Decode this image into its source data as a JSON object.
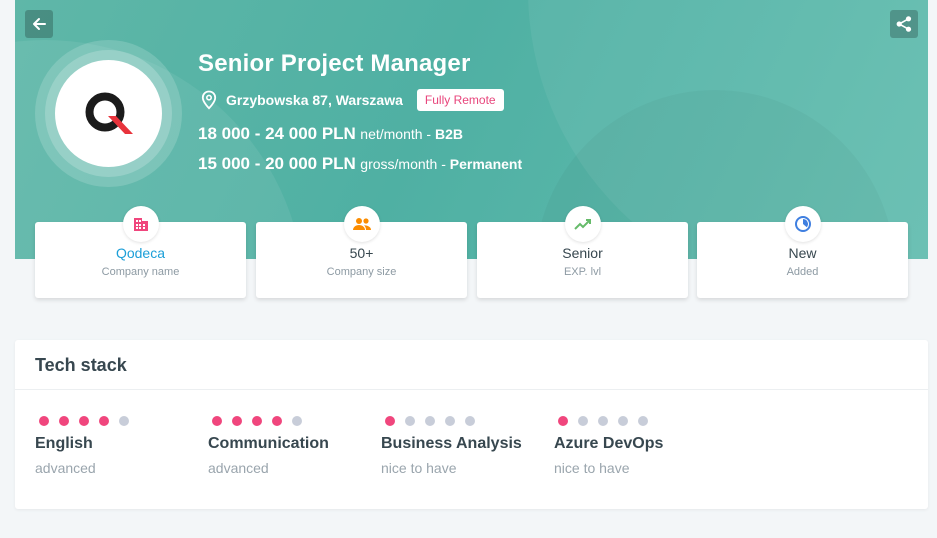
{
  "header": {
    "title": "Senior Project Manager",
    "location": "Grzybowska 87, Warszawa",
    "remote_badge": "Fully Remote",
    "salaries": [
      {
        "amount": "18 000 - 24 000 PLN",
        "unit": "net/month",
        "sep": " - ",
        "type": "B2B"
      },
      {
        "amount": "15 000 - 20 000 PLN",
        "unit": "gross/month",
        "sep": " - ",
        "type": "Permanent"
      }
    ],
    "back_icon": "arrow-left-icon",
    "share_icon": "share-icon",
    "logo_icon": "company-logo-q"
  },
  "cards": [
    {
      "value": "Qodeca",
      "label": "Company name",
      "icon": "building-icon",
      "icon_color": "#f0467d"
    },
    {
      "value": "50+",
      "label": "Company size",
      "icon": "people-icon",
      "icon_color": "#fb8c00"
    },
    {
      "value": "Senior",
      "label": "EXP. lvl",
      "icon": "trending-up-icon",
      "icon_color": "#66bb6a"
    },
    {
      "value": "New",
      "label": "Added",
      "icon": "clock-icon",
      "icon_color": "#3f7fe0"
    }
  ],
  "tech_stack": {
    "title": "Tech stack",
    "skills": [
      {
        "name": "English",
        "level": "advanced",
        "rating": 4,
        "max": 5
      },
      {
        "name": "Communication",
        "level": "advanced",
        "rating": 4,
        "max": 5
      },
      {
        "name": "Business Analysis",
        "level": "nice to have",
        "rating": 1,
        "max": 5
      },
      {
        "name": "Azure DevOps",
        "level": "nice to have",
        "rating": 1,
        "max": 5
      }
    ]
  },
  "colors": {
    "hero": "#56b3a6",
    "accent_pink": "#f0467d",
    "link_blue": "#1c9fd8",
    "dot_inactive": "#c8cdd9"
  }
}
